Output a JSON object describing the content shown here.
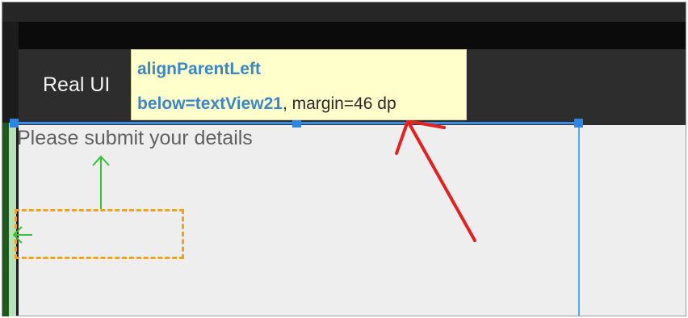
{
  "app_bar": {
    "title": "Real UI"
  },
  "content": {
    "text_view": "Please submit your details"
  },
  "tooltip": {
    "line1": "alignParentLeft",
    "line2_attribute": "below=textView21",
    "line2_rest": ", margin=46 dp"
  },
  "colors": {
    "selection_blue": "#3a8ee6",
    "margin_arrow_green": "#33c233",
    "placeholder_orange": "#f5a01a",
    "annotation_red": "#e52020",
    "tooltip_background": "#ffffcc",
    "tooltip_attribute_blue": "#3b88c4"
  },
  "icons": {
    "up_arrow": "margin-up-arrow-icon",
    "left_arrow": "margin-left-arrow-icon",
    "annotation": "red-annotation-arrow-icon"
  }
}
